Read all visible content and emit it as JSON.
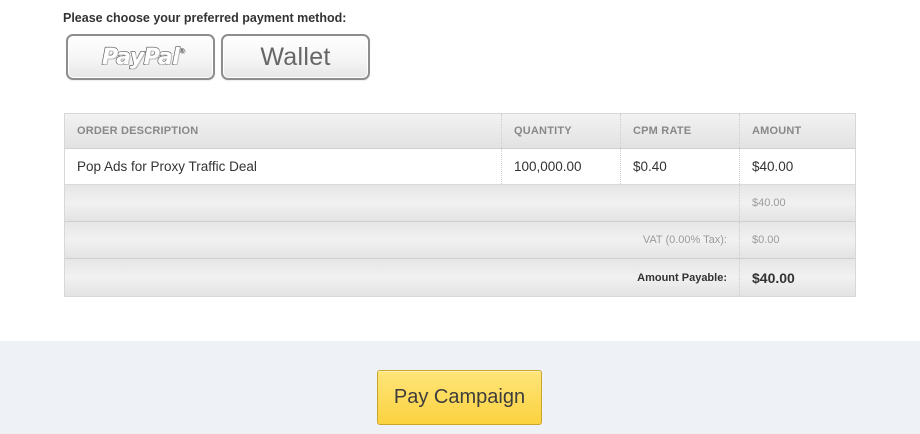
{
  "payment": {
    "prompt": "Please choose your preferred payment method:",
    "paypal_label": "PayPal",
    "paypal_mark": "®",
    "wallet_label": "Wallet"
  },
  "table": {
    "headers": {
      "description": "ORDER DESCRIPTION",
      "quantity": "QUANTITY",
      "cpm_rate": "CPM RATE",
      "amount": "AMOUNT"
    },
    "items": [
      {
        "description": "Pop Ads for Proxy Traffic Deal",
        "quantity": "100,000.00",
        "cpm_rate": "$0.40",
        "amount": "$40.00"
      }
    ],
    "subtotal": "$40.00",
    "vat_label": "VAT (0.00% Tax):",
    "vat_value": "$0.00",
    "payable_label": "Amount Payable:",
    "payable_value": "$40.00"
  },
  "actions": {
    "pay_campaign": "Pay Campaign"
  }
}
